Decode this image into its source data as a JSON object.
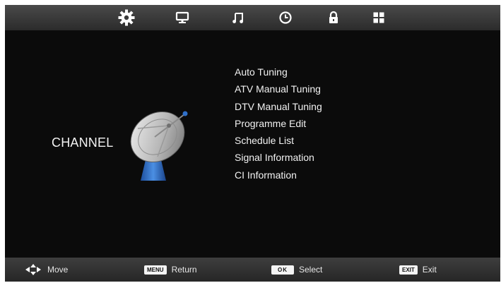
{
  "tabs": [
    {
      "icon": "gear-icon",
      "active": true
    },
    {
      "icon": "monitor-icon",
      "active": false
    },
    {
      "icon": "music-note-icon",
      "active": false
    },
    {
      "icon": "clock-icon",
      "active": false
    },
    {
      "icon": "lock-icon",
      "active": false
    },
    {
      "icon": "apps-grid-icon",
      "active": false
    }
  ],
  "section": {
    "title": "CHANNEL",
    "icon": "satellite-dish-icon"
  },
  "menu": {
    "items": [
      {
        "label": "Auto Tuning"
      },
      {
        "label": "ATV Manual Tuning"
      },
      {
        "label": "DTV Manual Tuning"
      },
      {
        "label": "Programme Edit"
      },
      {
        "label": "Schedule List"
      },
      {
        "label": "Signal Information"
      },
      {
        "label": "CI Information"
      }
    ]
  },
  "footer": {
    "move": {
      "icon": "arrows-move-icon",
      "label": "Move"
    },
    "menu": {
      "key": "MENU",
      "label": "Return"
    },
    "ok": {
      "key": "OK",
      "label": "Select"
    },
    "exit": {
      "key": "EXIT",
      "label": "Exit"
    }
  },
  "colors": {
    "background": "#0b0b0b",
    "text": "#f2f2f2",
    "bar": "#3a3a3a",
    "dish_base": "#2f6fc9"
  }
}
